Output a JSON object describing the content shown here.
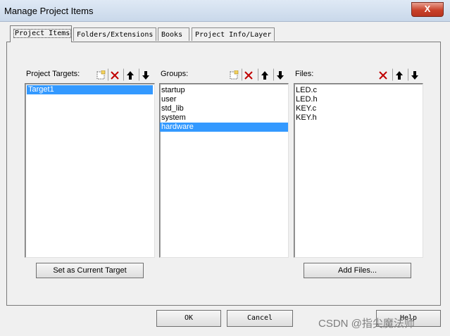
{
  "window": {
    "title": "Manage Project Items",
    "close_glyph": "X"
  },
  "tabs": [
    {
      "label": "Project Items",
      "active": true
    },
    {
      "label": "Folders/Extensions",
      "active": false
    },
    {
      "label": "Books",
      "active": false
    },
    {
      "label": "Project Info/Layer",
      "active": false
    }
  ],
  "targets": {
    "label": "Project Targets:",
    "items": [
      "Target1"
    ],
    "selected_index": 0
  },
  "groups": {
    "label": "Groups:",
    "items": [
      "startup",
      "user",
      "std_lib",
      "system",
      "hardware"
    ],
    "selected_index": 4
  },
  "files": {
    "label": "Files:",
    "items": [
      "LED.c",
      "LED.h",
      "KEY.c",
      "KEY.h"
    ]
  },
  "buttons": {
    "set_current_target": "Set as Current Target",
    "add_files": "Add Files...",
    "ok": "OK",
    "cancel": "Cancel",
    "help": "Help"
  },
  "icons": {
    "new": "new-icon",
    "delete": "delete-icon",
    "up": "move-up-icon",
    "down": "move-down-icon"
  },
  "colors": {
    "selection": "#3399ff",
    "delete_red": "#c00000"
  },
  "watermark": "CSDN @指尖魔法师"
}
